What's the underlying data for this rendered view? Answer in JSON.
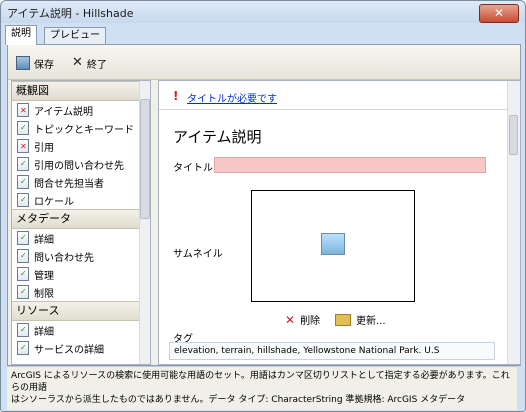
{
  "window": {
    "title": "アイテム説明 - Hillshade",
    "close_label": "✕"
  },
  "tabs": [
    {
      "label": "説明"
    },
    {
      "label": "プレビュー"
    }
  ],
  "toolbar": {
    "save_label": "保存",
    "close_label": "終了"
  },
  "sidebar": {
    "sections": [
      {
        "title": "概観図",
        "items": [
          {
            "label": "アイテム説明",
            "state": "error"
          },
          {
            "label": "トピックとキーワード",
            "state": "ok"
          },
          {
            "label": "引用",
            "state": "error"
          },
          {
            "label": "引用の問い合わせ先",
            "state": "ok"
          },
          {
            "label": "問合せ先担当者",
            "state": "ok"
          },
          {
            "label": "ロケール",
            "state": "ok"
          }
        ]
      },
      {
        "title": "メタデータ",
        "items": [
          {
            "label": "詳細",
            "state": "ok"
          },
          {
            "label": "問い合わせ先",
            "state": "ok"
          },
          {
            "label": "管理",
            "state": "ok"
          },
          {
            "label": "制限",
            "state": "ok"
          }
        ]
      },
      {
        "title": "リソース",
        "items": [
          {
            "label": "詳細",
            "state": "ok"
          },
          {
            "label": "サービスの詳細",
            "state": "ok"
          }
        ]
      }
    ]
  },
  "main": {
    "warning_text": "タイトルが必要です",
    "heading": "アイテム説明",
    "title_label": "タイトル",
    "title_value": "",
    "thumbnail_label": "サムネイル",
    "delete_label": "削除",
    "update_label": "更新...",
    "tags_label": "タグ",
    "tags_value": "elevation, terrain, hillshade, Yellowstone National Park. U.S"
  },
  "status": {
    "line1": "ArcGIS によるリソースの検索に使用可能な用語のセット。用語はカンマ区切りリストとして指定する必要があります。これらの用語",
    "line2": "はシソーラスから派生したものではありません。データ タイプ: CharacterString 準拠規格: ArcGIS メタデータ"
  },
  "colors": {
    "warning_fill": "#f7c7c7",
    "link": "#0033cc"
  }
}
